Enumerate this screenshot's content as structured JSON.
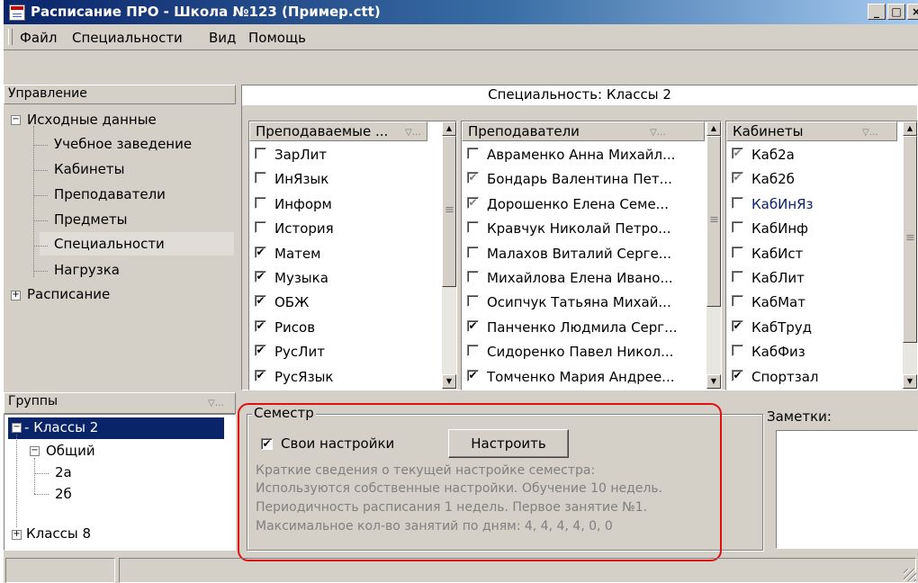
{
  "window": {
    "title": "Расписание ПРО - Школа №123 (Пример.ctt)",
    "controls": [
      "_",
      "□",
      "×"
    ]
  },
  "menu": [
    "Файл",
    "Специальности",
    "Вид",
    "Помощь"
  ],
  "management": {
    "header": "Управление",
    "tree": [
      {
        "label": "Исходные данные",
        "expander": "⊟"
      },
      {
        "label": "Учебное заведение"
      },
      {
        "label": "Кабинеты"
      },
      {
        "label": "Преподаватели"
      },
      {
        "label": "Предметы"
      },
      {
        "label": "Специальности"
      },
      {
        "label": "Нагрузка"
      },
      {
        "label": "Расписание",
        "expander": "⊞"
      }
    ]
  },
  "groups": {
    "header": "Группы",
    "tree": [
      {
        "label": "Классы 2"
      },
      {
        "label": "Общий"
      },
      {
        "label": "2а"
      },
      {
        "label": "2б"
      },
      {
        "label": "Классы 8"
      }
    ]
  },
  "specialty_header": "Специальность: Классы 2",
  "subjects": {
    "header": "Преподаваемые ...",
    "items": [
      {
        "label": "ЗарЛит",
        "checked": false
      },
      {
        "label": "ИнЯзык",
        "checked": false
      },
      {
        "label": "Информ",
        "checked": false
      },
      {
        "label": "История",
        "checked": false
      },
      {
        "label": "Матем",
        "checked": true
      },
      {
        "label": "Музыка",
        "checked": true
      },
      {
        "label": "ОБЖ",
        "checked": true
      },
      {
        "label": "Рисов",
        "checked": true
      },
      {
        "label": "РусЛит",
        "checked": true
      },
      {
        "label": "РусЯзык",
        "checked": true
      }
    ]
  },
  "teachers": {
    "header": "Преподаватели",
    "items": [
      {
        "label": "Авраменко Анна Михайл...",
        "checked": false
      },
      {
        "label": "Бондарь Валентина Пет...",
        "checked": "grey"
      },
      {
        "label": "Дорошенко Елена Семе...",
        "checked": "grey"
      },
      {
        "label": "Кравчук Николай Петро...",
        "checked": false
      },
      {
        "label": "Малахов Виталий Серге...",
        "checked": false
      },
      {
        "label": "Михайлова Елена Ивано...",
        "checked": false
      },
      {
        "label": "Осипчук Татьяна Михай...",
        "checked": false
      },
      {
        "label": "Панченко Людмила Серг...",
        "checked": true
      },
      {
        "label": "Сидоренко Павел Никол...",
        "checked": false
      },
      {
        "label": "Томченко Мария Андрее...",
        "checked": true
      }
    ]
  },
  "rooms": {
    "header": "Кабинеты",
    "items": [
      {
        "label": "Каб2а",
        "checked": "grey"
      },
      {
        "label": "Каб2б",
        "checked": "grey"
      },
      {
        "label": "КабИнЯз",
        "checked": false,
        "highlight": true
      },
      {
        "label": "КабИнф",
        "checked": false
      },
      {
        "label": "КабИст",
        "checked": false
      },
      {
        "label": "КабЛит",
        "checked": false
      },
      {
        "label": "КабМат",
        "checked": false
      },
      {
        "label": "КабТруд",
        "checked": true
      },
      {
        "label": "КабФиз",
        "checked": false
      },
      {
        "label": "Спортзал",
        "checked": true
      }
    ]
  },
  "semester": {
    "title": "Семестр",
    "own_settings_label": "Свои настройки",
    "own_settings_checked": true,
    "configure_button": "Настроить",
    "info": [
      "Краткие сведения о текущей настройке семестра:",
      "Используются собственные настройки. Обучение 10 недель.",
      "Периодичность расписания 1 недель. Первое занятие №1.",
      "Максимальное кол-во занятий по дням: 4, 4, 4, 4, 0, 0"
    ]
  },
  "notes": {
    "title": "Заметки:"
  },
  "colors": {
    "titlebar_start": "#0a246a",
    "titlebar_end": "#a6caf0",
    "highlight_outline": "#e01010",
    "face": "#d4d0c8"
  }
}
